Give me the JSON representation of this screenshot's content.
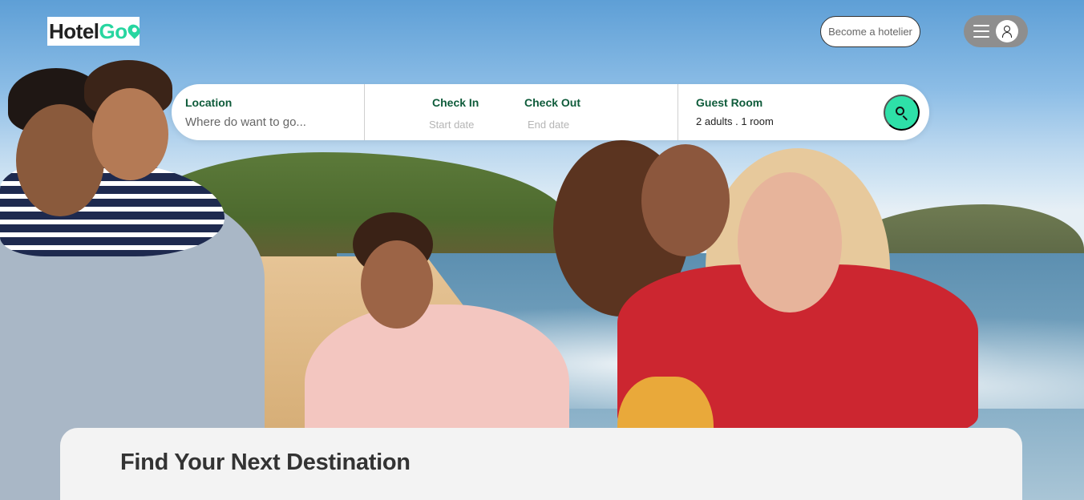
{
  "header": {
    "logo": {
      "text_main": "Hotel",
      "text_accent": "Go",
      "accent_color": "#27d6a0"
    },
    "become_hotelier_label": "Become a hotelier",
    "menu_icon": "hamburger-icon",
    "avatar_icon": "user-icon"
  },
  "search": {
    "location": {
      "label": "Location",
      "placeholder": "Where do want to go..."
    },
    "check_in": {
      "label": "Check In",
      "placeholder": "Start date"
    },
    "check_out": {
      "label": "Check Out",
      "placeholder": "End date"
    },
    "guest_room": {
      "label": "Guest Room",
      "value": "2 adults . 1 room"
    },
    "button_icon": "search-icon",
    "button_color": "#2ee0a8",
    "label_color": "#0e5b3a"
  },
  "main": {
    "section_title": "Find Your Next Destination"
  }
}
